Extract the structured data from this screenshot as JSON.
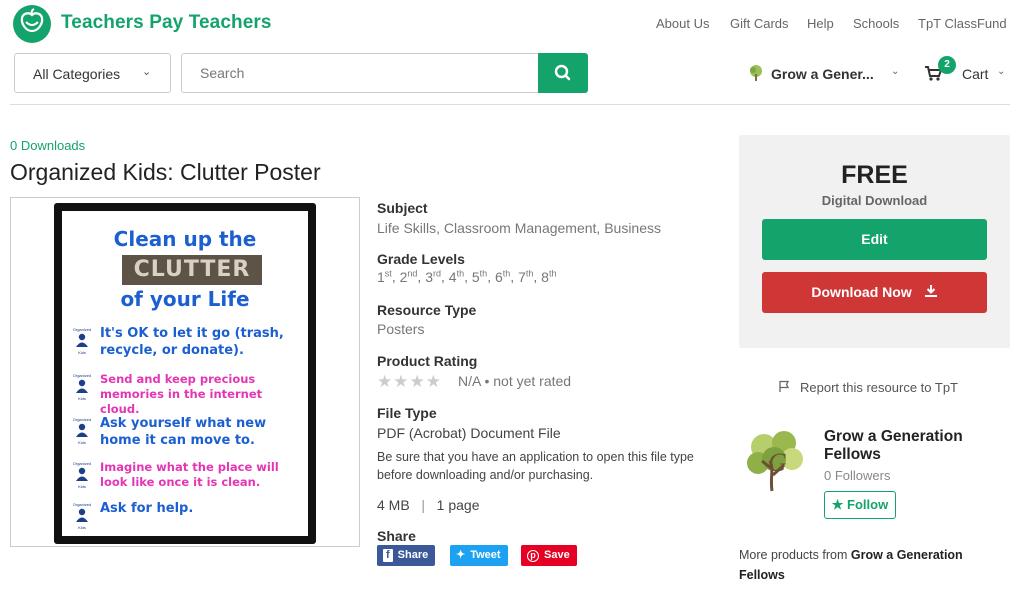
{
  "header": {
    "brand": "Teachers Pay Teachers",
    "top_links": [
      "About Us",
      "Gift Cards",
      "Help",
      "Schools",
      "TpT ClassFund"
    ],
    "category_select": "All Categories",
    "search_placeholder": "Search",
    "account_name": "Grow a Gener...",
    "cart_label": "Cart",
    "cart_count": "2"
  },
  "product": {
    "downloads": "0 Downloads",
    "title": "Organized Kids: Clutter Poster",
    "subject_label": "Subject",
    "subject_value": "Life Skills, Classroom Management, Business",
    "grades_label": "Grade Levels",
    "grades": [
      {
        "num": "1",
        "sfx": "st"
      },
      {
        "num": "2",
        "sfx": "nd"
      },
      {
        "num": "3",
        "sfx": "rd"
      },
      {
        "num": "4",
        "sfx": "th"
      },
      {
        "num": "5",
        "sfx": "th"
      },
      {
        "num": "6",
        "sfx": "th"
      },
      {
        "num": "7",
        "sfx": "th"
      },
      {
        "num": "8",
        "sfx": "th"
      }
    ],
    "resource_type_label": "Resource Type",
    "resource_type_value": "Posters",
    "rating_label": "Product Rating",
    "rating_value": "N/A",
    "rating_note": "not yet rated",
    "rating_stars": 4,
    "file_type_label": "File Type",
    "file_type_value": "PDF (Acrobat) Document File",
    "file_note": "Be sure that you have an application to open this file type before downloading and/or purchasing.",
    "file_size": "4 MB",
    "file_pages": "1 page",
    "share_label": "Share",
    "share_buttons": {
      "facebook": "Share",
      "twitter": "Tweet",
      "pinterest": "Save"
    },
    "poster": {
      "line1": "Clean up the",
      "line2": "CLUTTER",
      "line3": "of your Life",
      "badge_top": "Organized",
      "badge_bottom": "Kids",
      "items": [
        {
          "text": "It's OK to let it go (trash, recycle, or donate).",
          "color": "#1c5fd0"
        },
        {
          "text": "Send and keep precious memories in the internet cloud.",
          "color": "#e535b5"
        },
        {
          "text": "Ask yourself what new home it can move to.",
          "color": "#1c5fd0"
        },
        {
          "text": "Imagine what the place will look like once it is clean.",
          "color": "#e535b5"
        },
        {
          "text": "Ask for help.",
          "color": "#1c5fd0"
        }
      ]
    }
  },
  "purchase": {
    "price": "FREE",
    "price_sub": "Digital Download",
    "edit_button": "Edit",
    "download_button": "Download Now"
  },
  "report_link": "Report this resource to TpT",
  "seller": {
    "name": "Grow a Generation Fellows",
    "followers": "0 Followers",
    "follow_button": "Follow",
    "more_prefix": "More products from",
    "more_name": "Grow a Generation Fellows"
  },
  "colors": {
    "brand_green": "#15a36c",
    "download_red": "#cf3737",
    "poster_blue": "#1c5fd0",
    "poster_pink": "#e535b5"
  }
}
